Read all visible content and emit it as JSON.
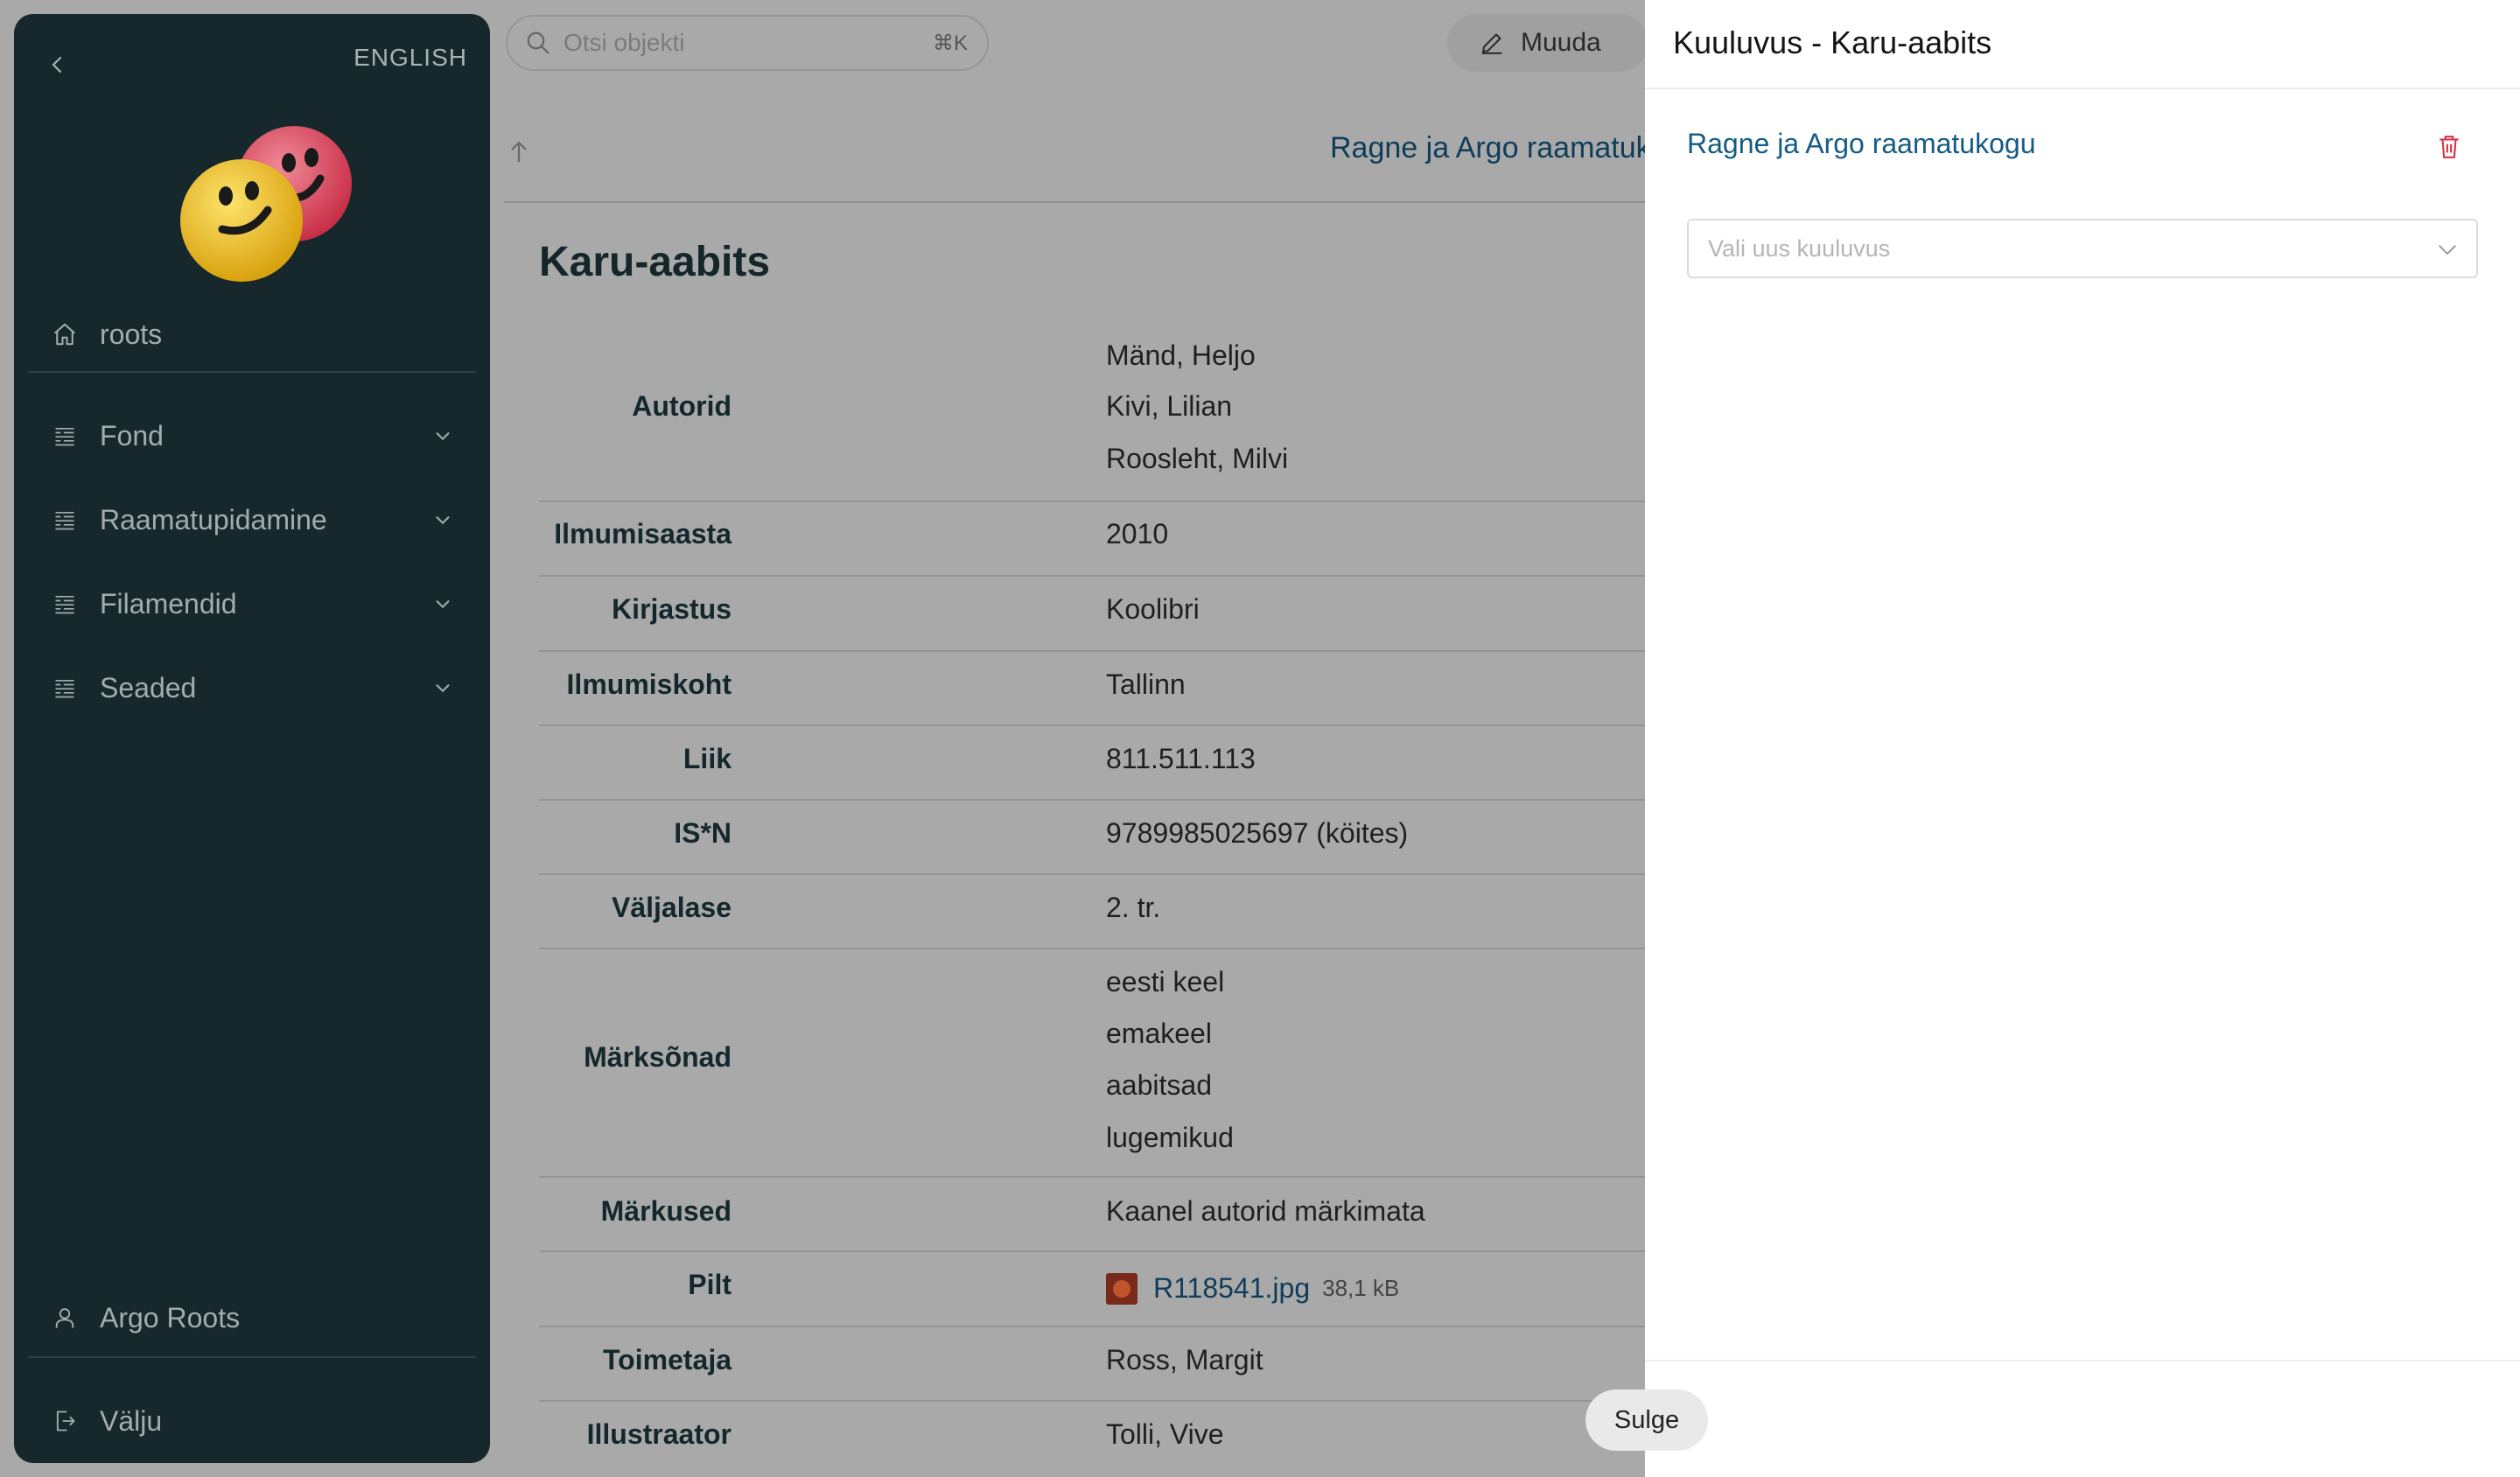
{
  "sidebar": {
    "language": "ENGLISH",
    "home": "roots",
    "menu": [
      {
        "label": "Fond"
      },
      {
        "label": "Raamatupidamine"
      },
      {
        "label": "Filamendid"
      },
      {
        "label": "Seaded"
      }
    ],
    "user": "Argo Roots",
    "logout": "Välju"
  },
  "topbar": {
    "search_placeholder": "Otsi objekti",
    "shortcut": "⌘K",
    "edit_label": "Muuda"
  },
  "breadcrumb": {
    "collection": "Ragne ja Argo raamatuko"
  },
  "record": {
    "title": "Karu-aabits",
    "fields": {
      "autorid_label": "Autorid",
      "autorid": [
        "Mänd, Heljo",
        "Kivi, Lilian",
        "Roosleht, Milvi"
      ],
      "ilmumisaasta_label": "Ilmumisaasta",
      "ilmumisaasta": "2010",
      "kirjastus_label": "Kirjastus",
      "kirjastus": "Koolibri",
      "ilmumiskoht_label": "Ilmumiskoht",
      "ilmumiskoht": "Tallinn",
      "liik_label": "Liik",
      "liik": "811.511.113",
      "isn_label": "IS*N",
      "isn": "9789985025697 (köites)",
      "valjalase_label": "Väljalase",
      "valjalase": "2. tr.",
      "marksonad_label": "Märksõnad",
      "marksonad": [
        "eesti keel",
        "emakeel",
        "aabitsad",
        "lugemikud"
      ],
      "markused_label": "Märkused",
      "markused": "Kaanel autorid märkimata",
      "pilt_label": "Pilt",
      "pilt_file": "R118541.jpg",
      "pilt_size": "38,1 kB",
      "toimetaja_label": "Toimetaja",
      "toimetaja": "Ross, Margit",
      "illustraator_label": "Illustraator",
      "illustraator": "Tolli, Vive"
    }
  },
  "drawer": {
    "title": "Kuuluvus - Karu-aabits",
    "collection_link": "Ragne ja Argo raamatukogu",
    "select_placeholder": "Vali uus kuuluvus",
    "close_label": "Sulge"
  },
  "colors": {
    "sidebar_bg": "#17282d",
    "link": "#145b85",
    "delete": "#d0394a"
  },
  "icons": [
    "back-icon",
    "home-icon",
    "list-icon",
    "chevron-down-icon",
    "user-icon",
    "logout-icon",
    "search-icon",
    "pencil-icon",
    "arrow-up-icon",
    "trash-icon"
  ]
}
